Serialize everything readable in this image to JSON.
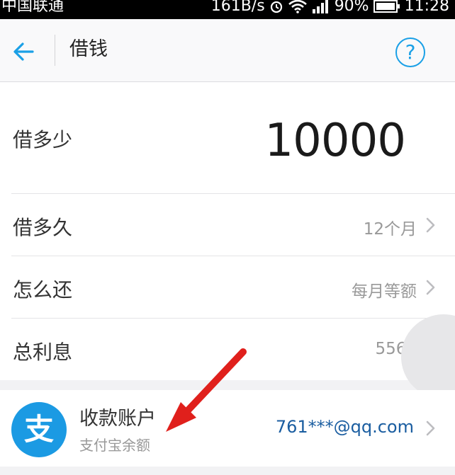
{
  "status_bar": {
    "carrier": "中国联通",
    "speed": "161B/s",
    "battery": "90%",
    "time": "11:28"
  },
  "nav": {
    "title": "借钱",
    "help_label": "?"
  },
  "form": {
    "amount_label": "借多少",
    "amount_value": "10000",
    "term_label": "借多久",
    "term_value": "12个月",
    "repay_label": "怎么还",
    "repay_value": "每月等额",
    "interest_label": "总利息",
    "interest_value": "556.10"
  },
  "account": {
    "logo_char": "支",
    "title": "收款账户",
    "subtitle": "支付宝余额",
    "email": "761***@qq.com"
  },
  "colors": {
    "accent": "#1aa0e6",
    "alipay_blue": "#1b9ae3",
    "annotation_red": "#e0201c"
  },
  "icons": {
    "back": "arrow-left-icon",
    "help": "question-circle-icon",
    "chevron": "chevron-right-icon",
    "alarm": "alarm-icon",
    "wifi": "wifi-icon",
    "signal": "signal-icon",
    "battery": "battery-icon"
  }
}
